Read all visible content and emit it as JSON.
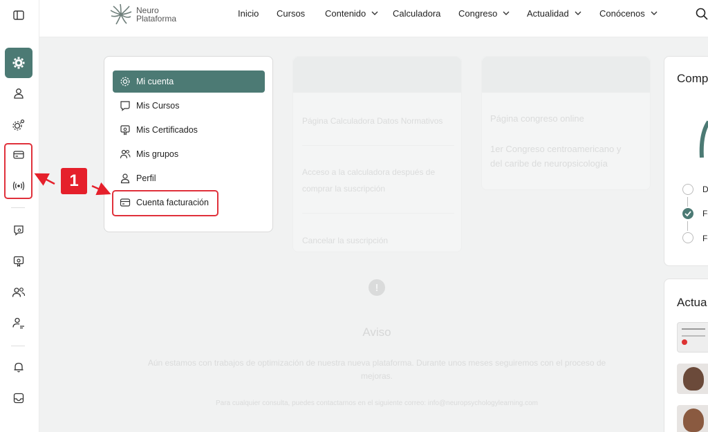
{
  "brand": {
    "line1": "Neuro",
    "line2": "Plataforma"
  },
  "nav": [
    {
      "label": "Inicio",
      "has_chevron": false
    },
    {
      "label": "Cursos",
      "has_chevron": false
    },
    {
      "label": "Contenido",
      "has_chevron": true
    },
    {
      "label": "Calculadora",
      "has_chevron": false
    },
    {
      "label": "Congreso",
      "has_chevron": true
    },
    {
      "label": "Actualidad",
      "has_chevron": true
    },
    {
      "label": "Conócenos",
      "has_chevron": true
    }
  ],
  "sidebar": {
    "icons": [
      "sidebar-toggle-icon",
      "gear-icon",
      "user-icon",
      "gears-icon",
      "credit-card-icon",
      "broadcast-icon",
      "certificate-icon",
      "certificate-badge-icon",
      "group-icon",
      "user-settings-icon",
      "bell-icon",
      "inbox-icon"
    ]
  },
  "account_menu": {
    "items": [
      {
        "label": "Mi cuenta",
        "icon": "gear-icon",
        "active": true
      },
      {
        "label": "Mis Cursos",
        "icon": "certificate-icon",
        "active": false
      },
      {
        "label": "Mis Certificados",
        "icon": "certificate-badge-icon",
        "active": false
      },
      {
        "label": "Mis grupos",
        "icon": "group-icon",
        "active": false
      },
      {
        "label": "Perfil",
        "icon": "user-icon",
        "active": false
      },
      {
        "label": "Cuenta facturación",
        "icon": "credit-card-icon",
        "active": false
      }
    ]
  },
  "callout": {
    "number": "1"
  },
  "colors": {
    "accent": "#4c7a74",
    "callout": "#e5202b"
  },
  "background_cards": {
    "calculator": {
      "title": "Página Calculadora Datos Normativos",
      "line1": "Acceso a la calculadora después de",
      "line2": "comprar la suscripción",
      "cancel": "Cancelar la suscripción"
    },
    "congress": {
      "title": "Página congreso online",
      "line1": "1er Congreso centroamericano y",
      "line2": "del caribe de neuropsicología"
    },
    "right_top": {
      "title": "Comp",
      "steps": [
        "D",
        "Fe",
        "Fe"
      ]
    },
    "right_bottom": {
      "title": "Actua"
    }
  },
  "notice": {
    "title": "Aviso",
    "body_line1": "Aún estamos con trabajos de optimización de nuestra nueva plataforma. Durante unos meses seguiremos con el proceso de",
    "body_line2": "mejoras.",
    "contact": "Para cualquier consulta, puedes contactarnos en el siguiente correo: info@neuropsychologylearning.com"
  }
}
